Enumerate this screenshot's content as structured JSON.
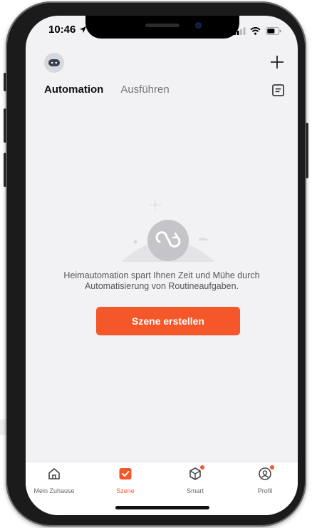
{
  "status_bar": {
    "time": "10:46"
  },
  "header": {
    "avatar_icon": "robot-avatar-icon",
    "add_icon": "plus-icon",
    "log_icon": "document-icon"
  },
  "tabs": [
    {
      "label": "Automation",
      "active": true
    },
    {
      "label": "Ausführen",
      "active": false
    }
  ],
  "empty_state": {
    "message": "Heimautomation spart Ihnen Zeit und Mühe durch Automatisierung von Routineaufgaben.",
    "button_label": "Szene erstellen"
  },
  "tab_bar": [
    {
      "label": "Mein Zuhause",
      "icon": "home-icon",
      "active": false,
      "badge": false
    },
    {
      "label": "Szene",
      "icon": "scene-check-icon",
      "active": true,
      "badge": false
    },
    {
      "label": "Smart",
      "icon": "cube-icon",
      "active": false,
      "badge": true
    },
    {
      "label": "Profil",
      "icon": "profile-icon",
      "active": false,
      "badge": true
    }
  ],
  "colors": {
    "accent": "#f4572a",
    "background": "#f2f2f5"
  }
}
